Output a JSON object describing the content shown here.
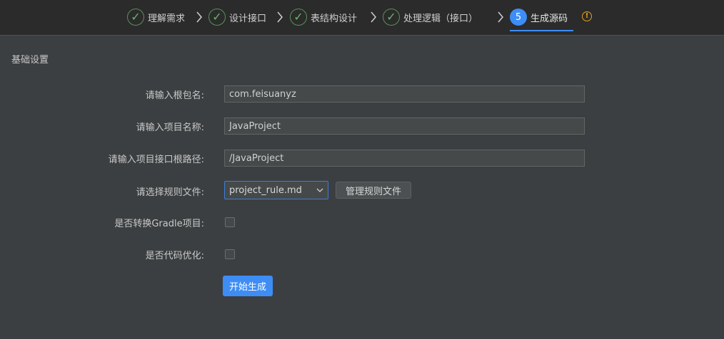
{
  "steps": [
    {
      "label": "理解需求",
      "status": "done"
    },
    {
      "label": "设计接口",
      "status": "done"
    },
    {
      "label": "表结构设计",
      "status": "done"
    },
    {
      "label": "处理逻辑（接口）",
      "status": "done"
    },
    {
      "label": "生成源码",
      "status": "active",
      "number": "5"
    }
  ],
  "section_title": "基础设置",
  "fields": {
    "root_package": {
      "label": "请输入根包名:",
      "value": "com.feisuanyz"
    },
    "project_name": {
      "label": "请输入项目名称:",
      "value": "JavaProject"
    },
    "root_path": {
      "label": "请输入项目接口根路径:",
      "value": "/JavaProject"
    },
    "rule_file": {
      "label": "请选择规则文件:",
      "value": "project_rule.md"
    },
    "gradle": {
      "label": "是否转换Gradle项目:",
      "checked": false
    },
    "optimize": {
      "label": "是否代码优化:",
      "checked": false
    }
  },
  "buttons": {
    "manage_rules": "管理规则文件",
    "start": "开始生成"
  },
  "colors": {
    "accent": "#3d8df5",
    "success": "#69b469",
    "warning": "#e5a117",
    "background": "#3c3f41"
  }
}
